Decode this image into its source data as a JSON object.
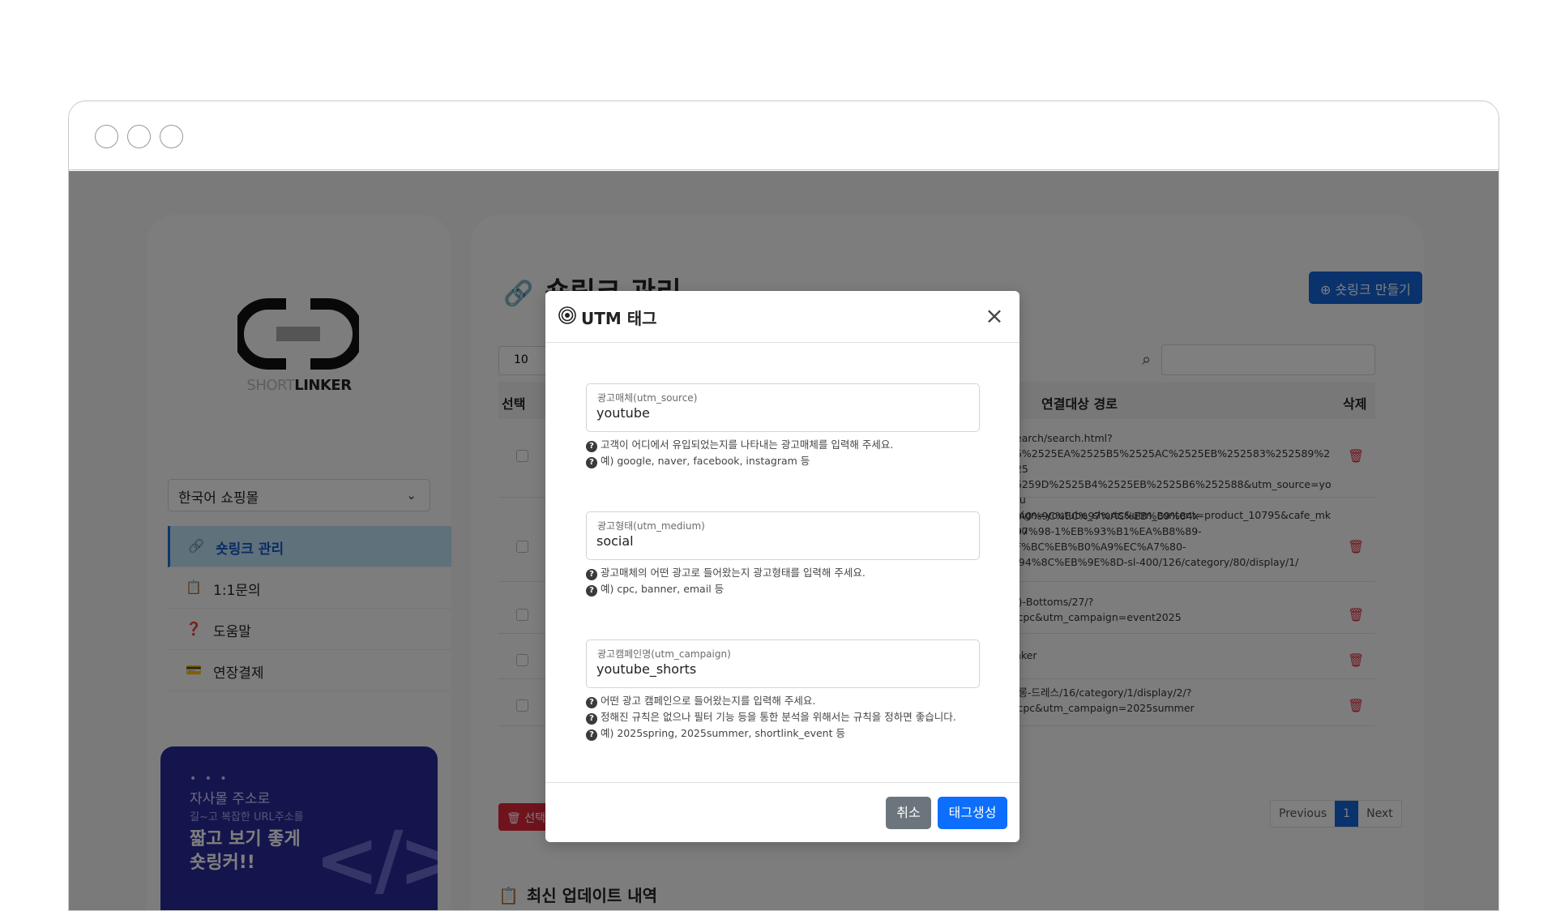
{
  "sidebar": {
    "logo_text_light": "SHORT",
    "logo_text_bold": "LINKER",
    "shop_select": "한국어 쇼핑몰",
    "items": [
      {
        "label": "숏링크 관리",
        "icon": "link-icon"
      },
      {
        "label": "1:1문의",
        "icon": "clipboard-icon"
      },
      {
        "label": "도움말",
        "icon": "question-icon"
      },
      {
        "label": "연장결제",
        "icon": "card-icon"
      }
    ],
    "promo": {
      "dots": "• • •",
      "line1": "자사몰 주소로",
      "line2": "길~고 복잡한 URL주소를",
      "line3": "짧고 보기 좋게 숏링커!!",
      "code": "</>"
    }
  },
  "main": {
    "title": "숏링크 관리",
    "create_label": "숏링크 만들기",
    "page_size": "10",
    "columns": {
      "select": "선택",
      "path": "연결대상 경로",
      "delete": "삭제"
    },
    "rows": [
      {
        "path": "Search/search.html?\n35%2525EA%2525B5%2525AC%2525EB%252583%252589%2525\n25259D%2525B4%2525EB%2525B6%252588&utm_source=youtu\npaign=youtube_shorts&utm_content=product_10795&cafe_mkt=u"
      },
      {
        "path": "%A0%9C%EC%97%AC%EB%B9%84x-\n697%98-1%EB%93%B1%EA%B8%89-\n9F%BC%EB%B0%A9%EC%A7%80-\n%94%8C%EB%9E%8D-sl-400/126/category/80/display/1/"
      },
      {
        "path": "류)-Bottoms/27/?\n=cpc&utm_campaign=event2025"
      },
      {
        "path": "linker"
      },
      {
        "path": "롱롱-드레스/16/category/1/display/2/?\n=cpc&utm_campaign=2025summer"
      }
    ],
    "delete_selected": "선택",
    "pager": {
      "prev": "Previous",
      "current": "1",
      "next": "Next"
    },
    "recent_title": "최신 업데이트 내역"
  },
  "modal": {
    "title": "UTM 태그",
    "fields": [
      {
        "label": "광고매체(utm_source)",
        "value": "youtube",
        "help": [
          "고객이 어디에서 유입되었는지를 나타내는 광고매체를 입력해 주세요.",
          "예) google, naver, facebook, instagram 등"
        ]
      },
      {
        "label": "광고형태(utm_medium)",
        "value": "social",
        "help": [
          "광고매체의 어떤 광고로 들어왔는지 광고형태를 입력해 주세요.",
          "예) cpc, banner, email 등"
        ]
      },
      {
        "label": "광고캠페인명(utm_campaign)",
        "value": "youtube_shorts",
        "help": [
          "어떤 광고 캠페인으로 들어왔는지를 입력해 주세요.",
          "정해진 규칙은 없으나 필터 기능 등을 통한 분석을 위해서는 규칙을 정하면 좋습니다.",
          "예) 2025spring, 2025summer, shortlink_event 등"
        ]
      }
    ],
    "help_icon_glyph": "?",
    "cancel_label": "취소",
    "create_label": "태그생성"
  },
  "colors": {
    "primary": "#0d6efd",
    "secondary": "#6c757d",
    "danger": "#e0263a",
    "promo_bg": "#2b2b9a"
  }
}
